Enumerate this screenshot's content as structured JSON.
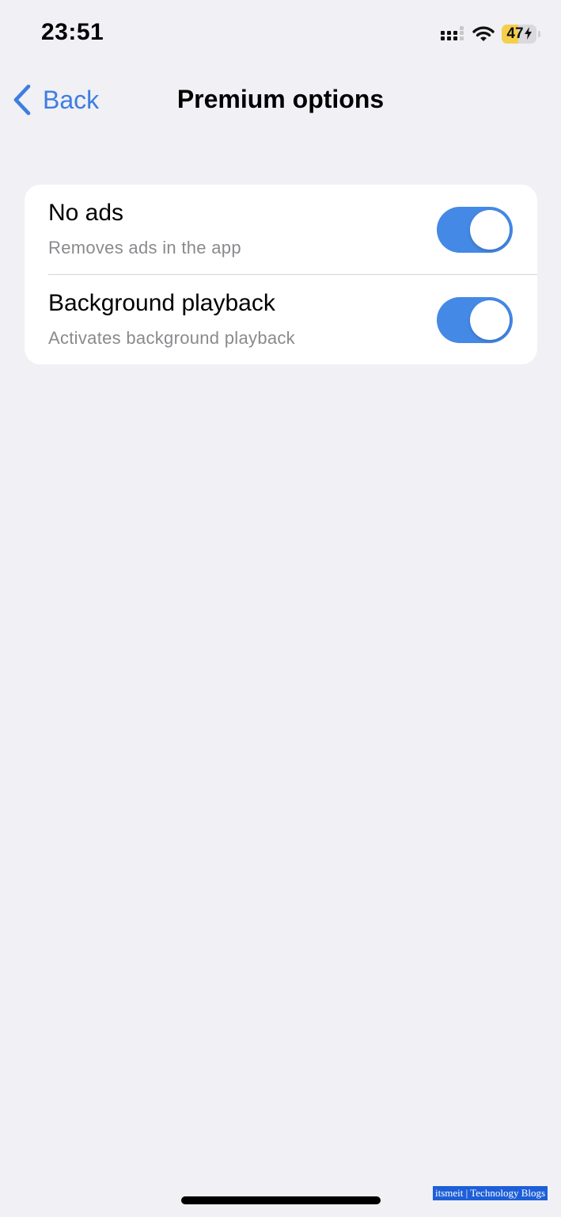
{
  "status_bar": {
    "time": "23:51",
    "battery_level": "47",
    "battery_fraction": 0.47,
    "battery_color": "#f5cf4b",
    "icons": [
      "signal-icon",
      "wifi-icon",
      "battery-icon",
      "charging-bolt-icon"
    ]
  },
  "nav": {
    "back_label": "Back",
    "title": "Premium options",
    "accent_color": "#3d7ee0"
  },
  "settings": {
    "items": [
      {
        "title": "No ads",
        "subtitle": "Removes ads in the app",
        "enabled": true
      },
      {
        "title": "Background playback",
        "subtitle": "Activates background playback",
        "enabled": true
      }
    ],
    "toggle_on_color": "#4589e6"
  },
  "watermark": "itsmeit | Technology Blogs"
}
